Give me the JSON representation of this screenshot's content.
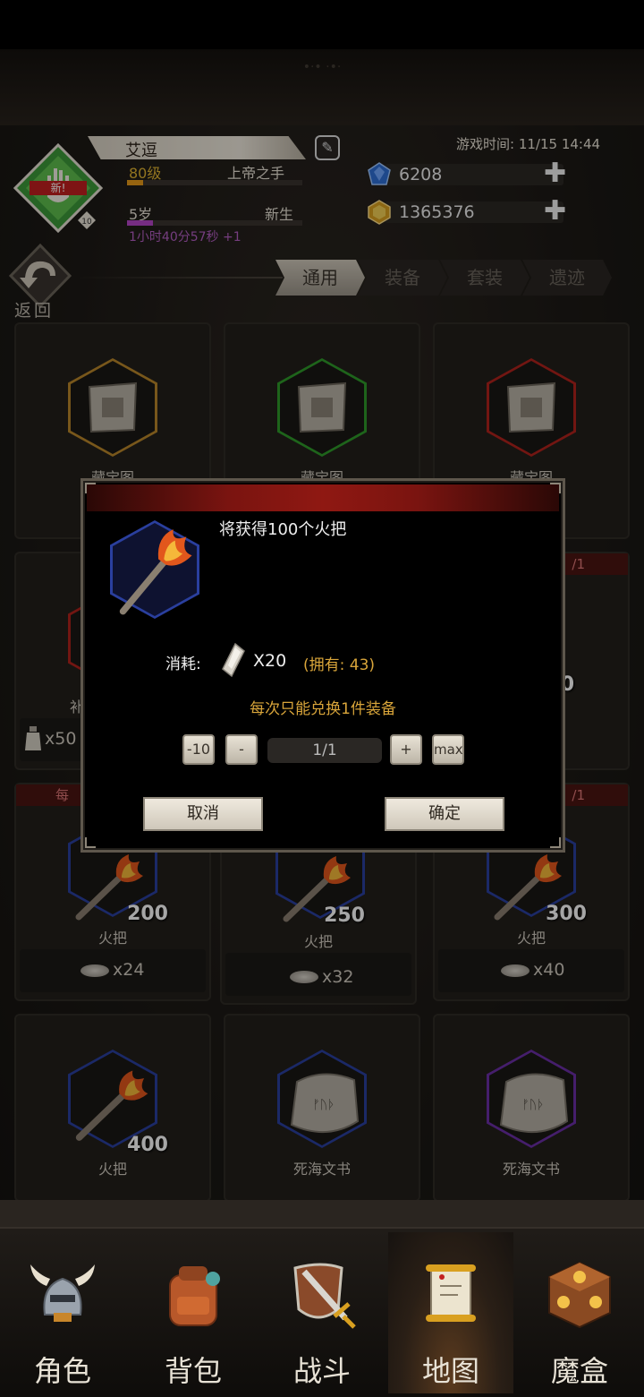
{
  "top_ghost_text": "•·• ·•·",
  "header": {
    "badge_text": "新!",
    "badge_level": "10",
    "name": "艾逗",
    "level": "80级",
    "title": "上帝之手",
    "age": "5岁",
    "stage": "新生",
    "age_time": "1小时40分57秒 +1",
    "level_progress": 0.09,
    "age_progress": 0.15,
    "game_time": "游戏时间: 11/15 14:44",
    "diamonds": "6208",
    "gold": "1365376",
    "plus": "✚"
  },
  "nav_top": {
    "back_label": "返回",
    "tabs": [
      {
        "label": "通用",
        "active": true
      },
      {
        "label": "装备",
        "active": false
      },
      {
        "label": "套装",
        "active": false
      },
      {
        "label": "遗迹",
        "active": false
      }
    ]
  },
  "grid": {
    "row1": [
      {
        "name": "藏宝图",
        "frame_color": "#b8862a"
      },
      {
        "name": "藏宝图",
        "frame_color": "#2f9a2a"
      },
      {
        "name": "藏宝图",
        "frame_color": "#b0221c"
      }
    ],
    "row2_left_name": "补",
    "row2_left_price": "x50",
    "row2_right_tag": "/1",
    "row2_right_count": "0",
    "row3": [
      {
        "name": "火把",
        "count": "200",
        "price": "x24",
        "tag": "每"
      },
      {
        "name": "火把",
        "count": "250",
        "price": "x32",
        "tag": ""
      },
      {
        "name": "火把",
        "count": "300",
        "price": "x40",
        "tag": "/1"
      }
    ],
    "row4": [
      {
        "name": "火把",
        "count": "400",
        "frame_color": "#2a3f9e"
      },
      {
        "name": "死海文书",
        "frame_color": "#2a3f9e"
      },
      {
        "name": "死海文书",
        "frame_color": "#6a2fa6"
      }
    ]
  },
  "dialog": {
    "gain_text": "将获得100个火把",
    "consume_label": "消耗:",
    "consume_amount": "X20",
    "owned": "(拥有: 43)",
    "note": "每次只能兑换1件装备",
    "minus10": "-10",
    "minus": "-",
    "quantity": "1/1",
    "plus": "+",
    "max": "max",
    "cancel": "取消",
    "confirm": "确定"
  },
  "bottom_nav": [
    {
      "label": "角色",
      "icon": "helmet-icon",
      "active": false
    },
    {
      "label": "背包",
      "icon": "backpack-icon",
      "active": false
    },
    {
      "label": "战斗",
      "icon": "sword-shield-icon",
      "active": false
    },
    {
      "label": "地图",
      "icon": "scroll-map-icon",
      "active": true
    },
    {
      "label": "魔盒",
      "icon": "magic-cube-icon",
      "active": false
    }
  ]
}
